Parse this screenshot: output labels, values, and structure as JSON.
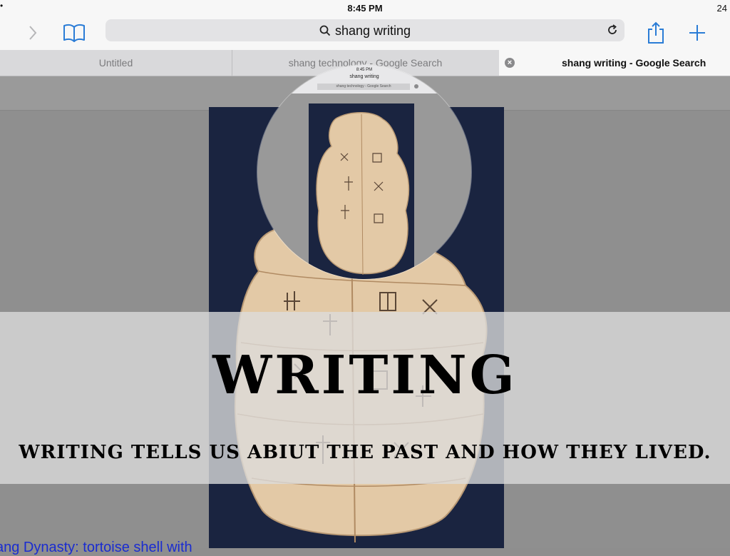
{
  "status": {
    "time": "8:45 PM",
    "left_glyph": "•",
    "right_text": "24"
  },
  "toolbar": {
    "search_text": "shang writing"
  },
  "tabs": [
    {
      "label": "Untitled"
    },
    {
      "label": "shang technology - Google Search"
    },
    {
      "label": "shang writing - Google Search"
    }
  ],
  "magnifier": {
    "time": "8:45 PM",
    "search_text": "shang writing",
    "tab_label": "shang technology - Google Search"
  },
  "overlay": {
    "title": "WRITING",
    "subtitle": "WRITING TELLS US ABIUT THE PAST AND HOW THEY LIVED."
  },
  "page": {
    "link_text": "ang Dynasty: tortoise shell with"
  },
  "colors": {
    "accent": "#2a7cd6",
    "link": "#1a2cd0",
    "shell": "#e3c9a6",
    "background_blue": "#1a2440"
  },
  "icons": [
    "chevron-right-icon",
    "book-icon",
    "search-icon",
    "reload-icon",
    "share-icon",
    "plus-icon",
    "close-tab-icon"
  ]
}
